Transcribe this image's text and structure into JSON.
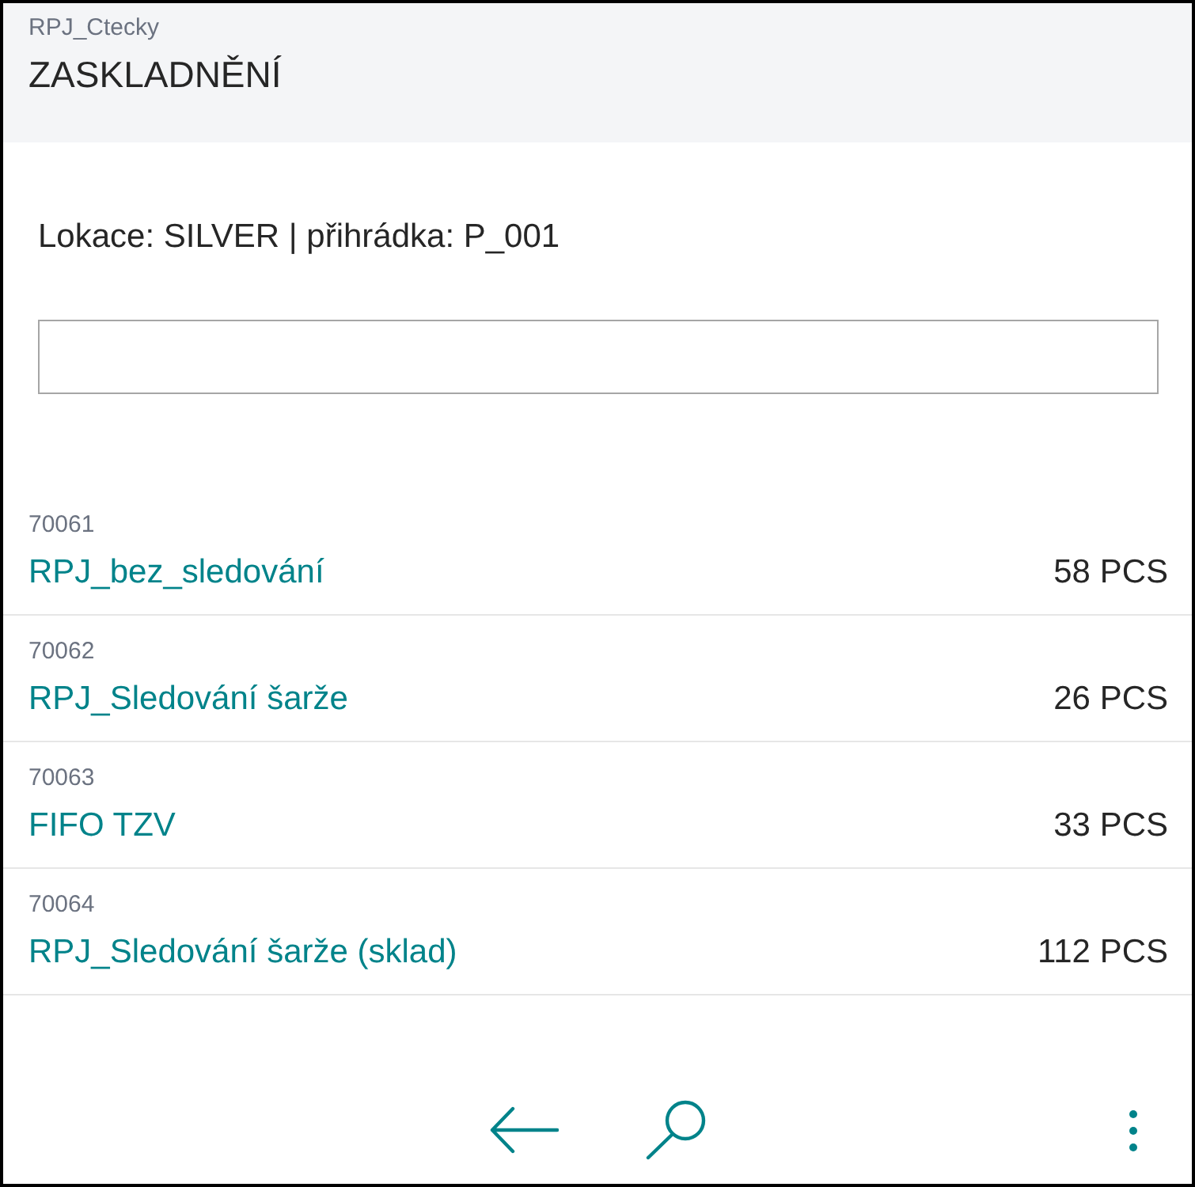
{
  "app": {
    "name": "RPJ_Ctecky",
    "page_title": "ZASKLADNĚNÍ"
  },
  "location": "Lokace: SILVER | přihrádka: P_001",
  "items": [
    {
      "number": "70061",
      "name": "RPJ_bez_sledování",
      "quantity": "58 PCS"
    },
    {
      "number": "70062",
      "name": "RPJ_Sledování šarže",
      "quantity": "26 PCS"
    },
    {
      "number": "70063",
      "name": "FIFO TZV",
      "quantity": "33 PCS"
    },
    {
      "number": "70064",
      "name": "RPJ_Sledování šarže (sklad)",
      "quantity": "112 PCS"
    }
  ]
}
